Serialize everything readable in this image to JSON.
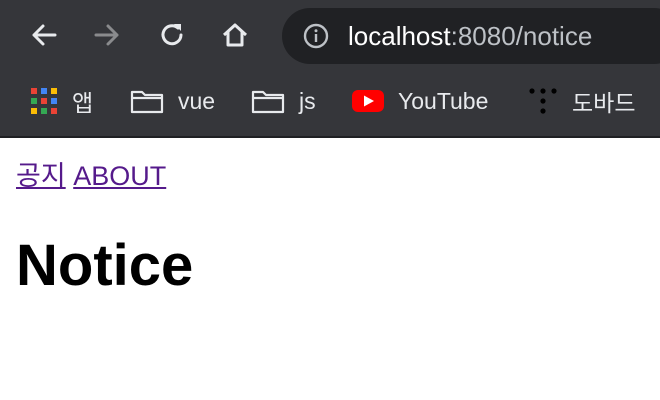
{
  "browser": {
    "url_host": "localhost",
    "url_rest": ":8080/notice",
    "bookmarks": [
      {
        "label": "앱",
        "icon": "apps-grid-icon"
      },
      {
        "label": "vue",
        "icon": "folder-icon"
      },
      {
        "label": "js",
        "icon": "folder-icon"
      },
      {
        "label": "YouTube",
        "icon": "youtube-icon"
      },
      {
        "label": "도바드",
        "icon": "dobad-icon"
      }
    ]
  },
  "page": {
    "nav": {
      "notice_link": "공지",
      "about_link": "ABOUT"
    },
    "heading": "Notice"
  },
  "colors": {
    "chrome_bg": "#35363a",
    "omnibox_bg": "#202124",
    "link": "#551a8b",
    "youtube_red": "#ff0000"
  }
}
